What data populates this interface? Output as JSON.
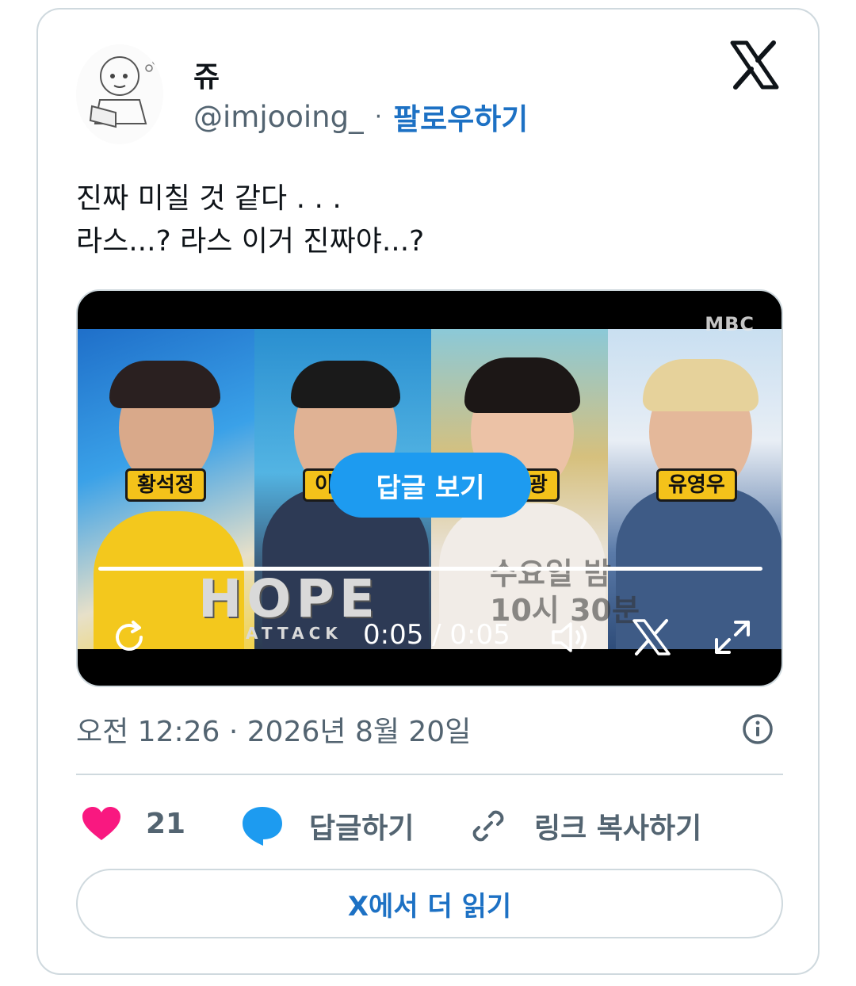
{
  "tweet": {
    "display_name": "쥬",
    "handle": "@imjooing_",
    "separator": "·",
    "follow_label": "팔로우하기",
    "text_line1": "진짜 미칠 것 같다 . . .",
    "text_line2": "라스...? 라스 이거 진짜야...?",
    "timestamp": "오전 12:26 · 2026년 8월 20일"
  },
  "media": {
    "watermark": "MBC",
    "name_tags": [
      "황석정",
      "이춘혁",
      "서은광",
      "유영우"
    ],
    "hope_text": "HOPE",
    "attack_text": "ATTACK",
    "schedule_line1": "수요일 밤",
    "schedule_line2": "10시 30분",
    "reply_button_label": "답글 보기",
    "time_display": "0:05 / 0:05",
    "progress_fraction": 1.0
  },
  "actions": {
    "like_count": "21",
    "reply_label": "답글하기",
    "copy_link_label": "링크 복사하기"
  },
  "read_more_label": "X에서 더 읽기",
  "colors": {
    "accent_blue": "#1d9bf0",
    "link_blue": "#1d71c4",
    "heart_pink": "#f91880",
    "secondary_text": "#536471",
    "border": "#cfd9de"
  }
}
